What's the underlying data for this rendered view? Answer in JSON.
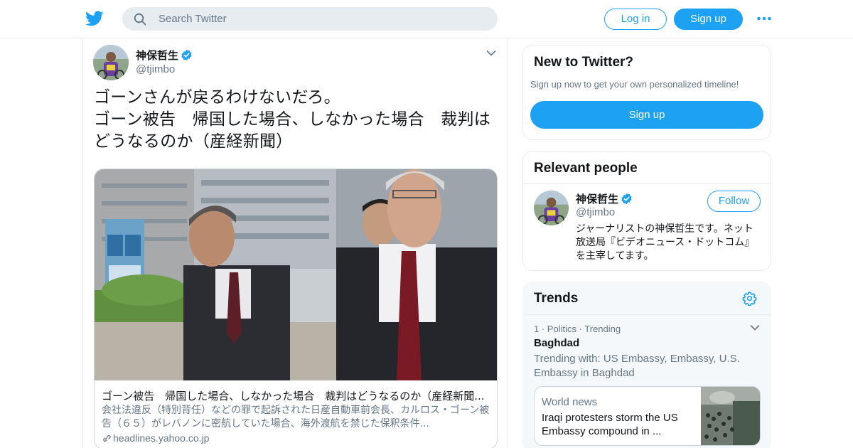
{
  "colors": {
    "accent": "#1da1f2",
    "text": "#14171a",
    "muted": "#657786",
    "border": "#e6ecf0"
  },
  "header": {
    "logo_icon": "twitter-bird-icon",
    "search_placeholder": "Search Twitter",
    "login_label": "Log in",
    "signup_label": "Sign up",
    "more_icon": "more-dots-icon"
  },
  "tweet": {
    "author_name": "神保哲生",
    "author_handle": "@tjimbo",
    "verified": true,
    "text_lines": [
      "ゴーンさんが戻るわけないだろ。",
      "ゴーン被告　帰国した場合、しなかった場合　裁判は",
      "どうなるのか（産経新聞）"
    ],
    "card": {
      "title": "ゴーン被告　帰国した場合、しなかった場合　裁判はどうなるのか（産経新聞...",
      "description": "会社法違反（特別背任）などの罪で起訴された日産自動車前会長、カルロス・ゴーン被告（６５）がレバノンに密航していた場合、海外渡航を禁じた保釈条件...",
      "domain": "headlines.yahoo.co.jp"
    }
  },
  "new_to_twitter": {
    "title": "New to Twitter?",
    "subtitle": "Sign up now to get your own personalized timeline!",
    "button_label": "Sign up"
  },
  "relevant_people": {
    "title": "Relevant people",
    "person": {
      "name": "神保哲生",
      "handle": "@tjimbo",
      "verified": true,
      "follow_label": "Follow",
      "bio": "ジャーナリストの神保哲生です。ネット放送局『ビデオニュース・ドットコム』を主宰してます。"
    }
  },
  "trends": {
    "title": "Trends",
    "items": [
      {
        "meta": "1 · Politics · Trending",
        "name": "Baghdad",
        "trending_with": "Trending with: US Embassy, Embassy, U.S. Embassy in Baghdad",
        "news": {
          "category": "World news",
          "headline": "Iraqi protesters storm the US Embassy compound in ..."
        }
      }
    ]
  }
}
